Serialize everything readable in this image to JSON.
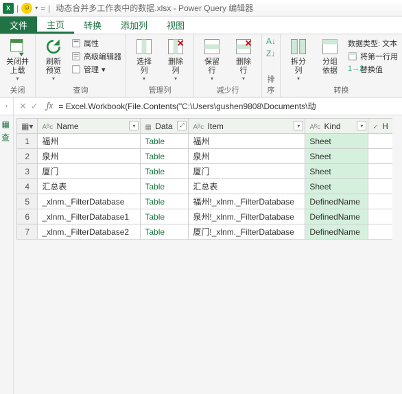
{
  "title": "动态合并多工作表中的数据.xlsx - Power Query 编辑器",
  "tabs": {
    "file": "文件",
    "home": "主页",
    "transform": "转换",
    "addcol": "添加列",
    "view": "视图"
  },
  "ribbon": {
    "close": {
      "btn": "关闭并\n上载",
      "group": "关闭"
    },
    "query": {
      "refresh": "刷新\n预览",
      "props": "属性",
      "adv": "高级编辑器",
      "manage": "管理",
      "group": "查询"
    },
    "cols": {
      "choose": "选择\n列",
      "remove": "删除\n列",
      "group": "管理列"
    },
    "rows": {
      "keep": "保留\n行",
      "remove": "删除\n行",
      "group": "减少行"
    },
    "sort": {
      "group": "排序"
    },
    "split": {
      "split": "拆分\n列",
      "groupby": "分组\n依据",
      "dtype": "数据类型: 文本",
      "firstrow": "将第一行用",
      "replace": "替换值",
      "group": "转换"
    }
  },
  "formula": "= Excel.Workbook(File.Contents(\"C:\\Users\\gushen9808\\Documents\\动",
  "table": {
    "headers": {
      "name": "Name",
      "data": "Data",
      "item": "Item",
      "kind": "Kind"
    },
    "rows": [
      {
        "n": "1",
        "name": "福州",
        "data": "Table",
        "item": "福州",
        "kind": "Sheet"
      },
      {
        "n": "2",
        "name": "泉州",
        "data": "Table",
        "item": "泉州",
        "kind": "Sheet"
      },
      {
        "n": "3",
        "name": "厦门",
        "data": "Table",
        "item": "厦门",
        "kind": "Sheet"
      },
      {
        "n": "4",
        "name": "汇总表",
        "data": "Table",
        "item": "汇总表",
        "kind": "Sheet"
      },
      {
        "n": "5",
        "name": "_xlnm._FilterDatabase",
        "data": "Table",
        "item": "福州!_xlnm._FilterDatabase",
        "kind": "DefinedName"
      },
      {
        "n": "6",
        "name": "_xlnm._FilterDatabase1",
        "data": "Table",
        "item": "泉州!_xlnm._FilterDatabase",
        "kind": "DefinedName"
      },
      {
        "n": "7",
        "name": "_xlnm._FilterDatabase2",
        "data": "Table",
        "item": "厦门!_xlnm._FilterDatabase",
        "kind": "DefinedName"
      }
    ]
  }
}
